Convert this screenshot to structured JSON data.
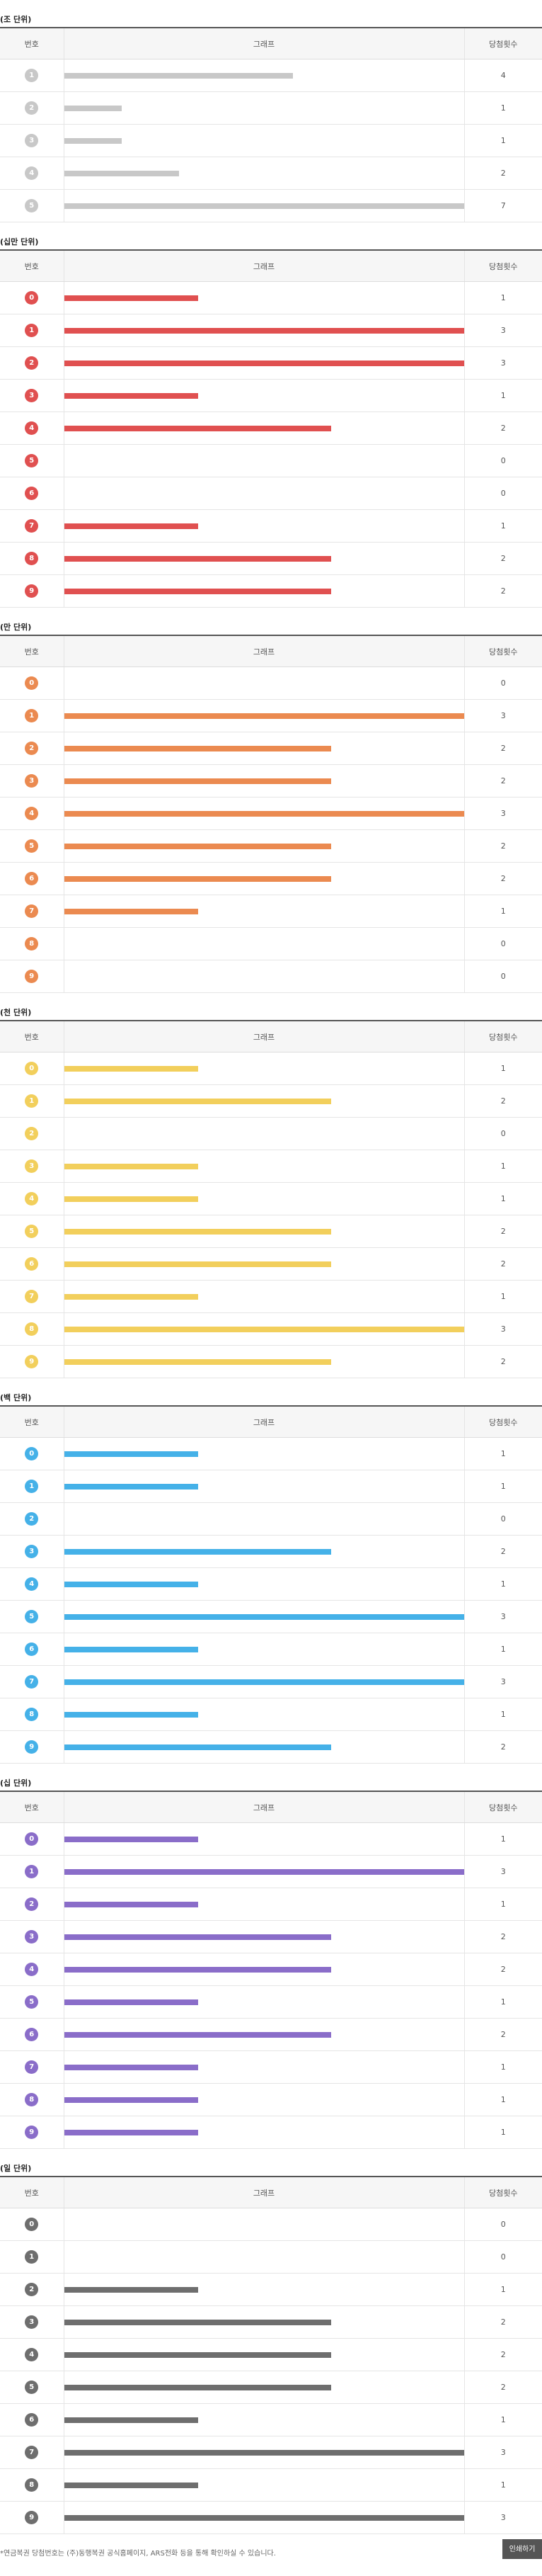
{
  "headers": {
    "num": "번호",
    "graph": "그래프",
    "count": "당첨횟수"
  },
  "max_count": 3,
  "sections": [
    {
      "title": "(조 단위)",
      "ball_color": "#c8c8c8",
      "bar_color": "#c8c8c8",
      "bar_max": 7,
      "rows": [
        {
          "num": "1",
          "count": 4
        },
        {
          "num": "2",
          "count": 1
        },
        {
          "num": "3",
          "count": 1
        },
        {
          "num": "4",
          "count": 2
        },
        {
          "num": "5",
          "count": 7
        }
      ]
    },
    {
      "title": "(십만 단위)",
      "ball_color": "#e05050",
      "bar_color": "#e05050",
      "bar_max": 3,
      "rows": [
        {
          "num": "0",
          "count": 1
        },
        {
          "num": "1",
          "count": 3
        },
        {
          "num": "2",
          "count": 3
        },
        {
          "num": "3",
          "count": 1
        },
        {
          "num": "4",
          "count": 2
        },
        {
          "num": "5",
          "count": 0
        },
        {
          "num": "6",
          "count": 0
        },
        {
          "num": "7",
          "count": 1
        },
        {
          "num": "8",
          "count": 2
        },
        {
          "num": "9",
          "count": 2
        }
      ]
    },
    {
      "title": "(만 단위)",
      "ball_color": "#eb8a50",
      "bar_color": "#eb8a50",
      "bar_max": 3,
      "rows": [
        {
          "num": "0",
          "count": 0
        },
        {
          "num": "1",
          "count": 3
        },
        {
          "num": "2",
          "count": 2
        },
        {
          "num": "3",
          "count": 2
        },
        {
          "num": "4",
          "count": 3
        },
        {
          "num": "5",
          "count": 2
        },
        {
          "num": "6",
          "count": 2
        },
        {
          "num": "7",
          "count": 1
        },
        {
          "num": "8",
          "count": 0
        },
        {
          "num": "9",
          "count": 0
        }
      ]
    },
    {
      "title": "(천 단위)",
      "ball_color": "#f2cf5c",
      "bar_color": "#f2cf5c",
      "bar_max": 3,
      "rows": [
        {
          "num": "0",
          "count": 1
        },
        {
          "num": "1",
          "count": 2
        },
        {
          "num": "2",
          "count": 0
        },
        {
          "num": "3",
          "count": 1
        },
        {
          "num": "4",
          "count": 1
        },
        {
          "num": "5",
          "count": 2
        },
        {
          "num": "6",
          "count": 2
        },
        {
          "num": "7",
          "count": 1
        },
        {
          "num": "8",
          "count": 3
        },
        {
          "num": "9",
          "count": 2
        }
      ]
    },
    {
      "title": "(백 단위)",
      "ball_color": "#45b1e8",
      "bar_color": "#45b1e8",
      "bar_max": 3,
      "rows": [
        {
          "num": "0",
          "count": 1
        },
        {
          "num": "1",
          "count": 1
        },
        {
          "num": "2",
          "count": 0
        },
        {
          "num": "3",
          "count": 2
        },
        {
          "num": "4",
          "count": 1
        },
        {
          "num": "5",
          "count": 3
        },
        {
          "num": "6",
          "count": 1
        },
        {
          "num": "7",
          "count": 3
        },
        {
          "num": "8",
          "count": 1
        },
        {
          "num": "9",
          "count": 2
        }
      ]
    },
    {
      "title": "(십 단위)",
      "ball_color": "#8a6dc9",
      "bar_color": "#8a6dc9",
      "bar_max": 3,
      "rows": [
        {
          "num": "0",
          "count": 1
        },
        {
          "num": "1",
          "count": 3
        },
        {
          "num": "2",
          "count": 1
        },
        {
          "num": "3",
          "count": 2
        },
        {
          "num": "4",
          "count": 2
        },
        {
          "num": "5",
          "count": 1
        },
        {
          "num": "6",
          "count": 2
        },
        {
          "num": "7",
          "count": 1
        },
        {
          "num": "8",
          "count": 1
        },
        {
          "num": "9",
          "count": 1
        }
      ]
    },
    {
      "title": "(일 단위)",
      "ball_color": "#6e6e6e",
      "bar_color": "#6e6e6e",
      "bar_max": 3,
      "rows": [
        {
          "num": "0",
          "count": 0
        },
        {
          "num": "1",
          "count": 0
        },
        {
          "num": "2",
          "count": 1
        },
        {
          "num": "3",
          "count": 2
        },
        {
          "num": "4",
          "count": 2
        },
        {
          "num": "5",
          "count": 2
        },
        {
          "num": "6",
          "count": 1
        },
        {
          "num": "7",
          "count": 3
        },
        {
          "num": "8",
          "count": 1
        },
        {
          "num": "9",
          "count": 3
        }
      ]
    }
  ],
  "footer": {
    "notice": "*연금복권 당첨번호는 (주)동행복권 공식홈페이지, ARS전화 등을 통해 확인하실 수 있습니다.",
    "print_label": "인쇄하기"
  }
}
